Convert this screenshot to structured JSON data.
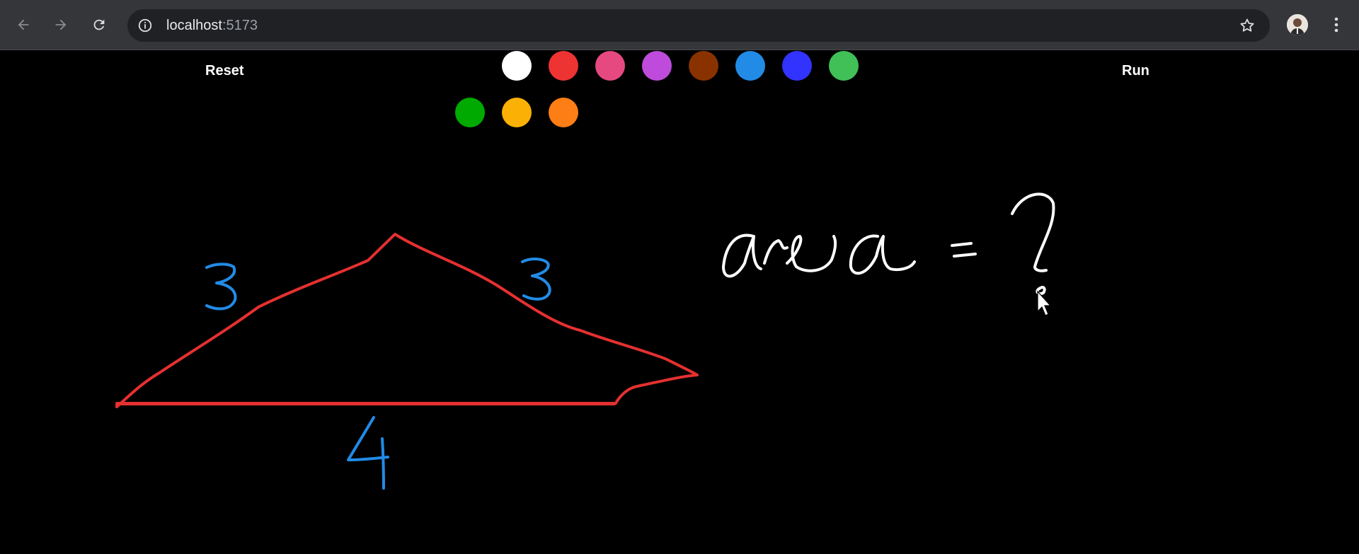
{
  "browser": {
    "url_host": "localhost",
    "url_port": ":5173",
    "icons": {
      "back": "arrow-left-icon",
      "forward": "arrow-right-icon",
      "reload": "reload-icon",
      "info": "info-icon",
      "bookmark": "star-icon",
      "profile": "avatar",
      "menu": "kebab-menu-icon"
    }
  },
  "toolbar": {
    "reset_label": "Reset",
    "run_label": "Run"
  },
  "palette": {
    "colors": [
      "#000000",
      "#ffffff",
      "#ee3333",
      "#e64980",
      "#be4bdb",
      "#893200",
      "#228be6",
      "#3333ff",
      "#40c057",
      "#00aa00",
      "#fab005",
      "#fd7e14"
    ]
  },
  "canvas": {
    "drawing": "hand-drawn red triangle with blue side labels and white text"
  }
}
